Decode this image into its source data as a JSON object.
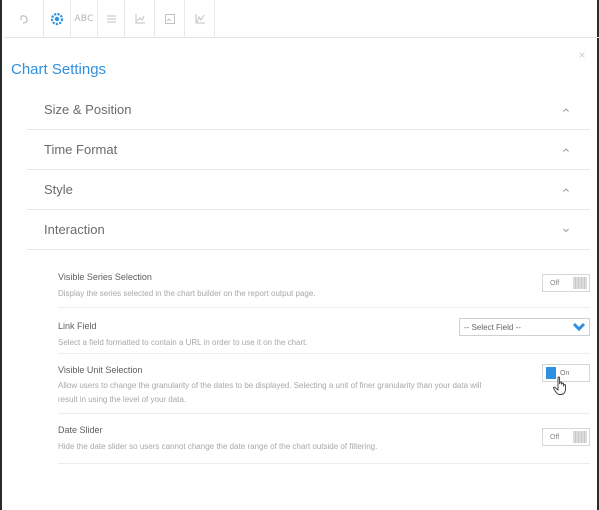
{
  "toolbar": {
    "tools": [
      {
        "icon": "undo-icon"
      },
      {
        "icon": "gear-icon",
        "active": true
      },
      {
        "icon": "abc-text-icon",
        "label": "ABC"
      },
      {
        "icon": "list-icon"
      },
      {
        "icon": "axis-icon"
      },
      {
        "icon": "image-icon"
      },
      {
        "icon": "chart-icon"
      }
    ]
  },
  "panel": {
    "title": "Chart Settings",
    "close_glyph": "×"
  },
  "sections": [
    {
      "label": "Size & Position",
      "state": "collapsed"
    },
    {
      "label": "Time Format",
      "state": "collapsed"
    },
    {
      "label": "Style",
      "state": "collapsed"
    },
    {
      "label": "Interaction",
      "state": "expanded"
    }
  ],
  "interaction": {
    "visible_series": {
      "name": "Visible Series Selection",
      "desc": "Display the series selected in the chart builder on the report output page.",
      "toggle": "Off"
    },
    "link_field": {
      "name": "Link Field",
      "desc": "Select a field formatted to contain a URL in order to use it on the chart.",
      "select_value": "-- Select Field --"
    },
    "visible_unit": {
      "name": "Visible Unit Selection",
      "desc": "Allow users to change the granularity of the dates to be displayed. Selecting a unit of finer granularity than your data will result in using the level of your data.",
      "toggle": "On"
    },
    "date_slider": {
      "name": "Date Slider",
      "desc": "Hide the date slider so users cannot change the date range of the chart outside of filtering.",
      "toggle": "Off"
    }
  },
  "colors": {
    "accent": "#2f8fe0",
    "border": "#e6e6e6"
  }
}
